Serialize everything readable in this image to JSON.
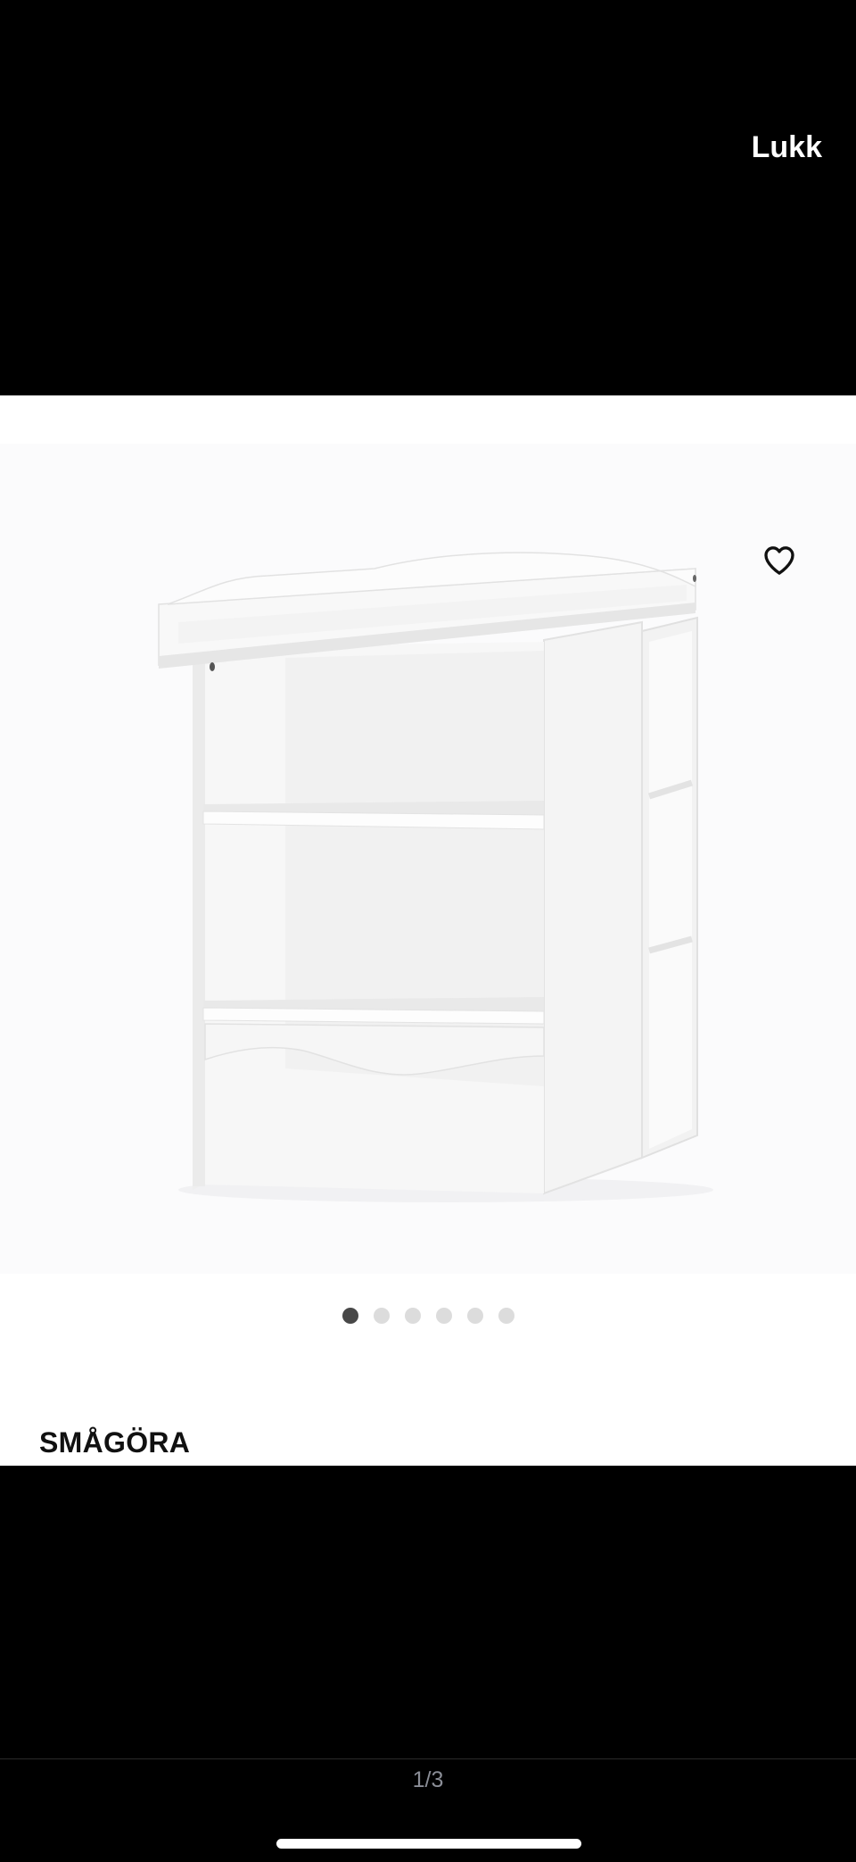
{
  "header": {
    "close_label": "Lukk"
  },
  "product": {
    "name": "SMÅGÖRA",
    "image_icon": "changing-table-bookshelf-image",
    "favorite_icon": "heart-outline-icon"
  },
  "carousel": {
    "total_dots": 6,
    "active_index": 0
  },
  "footer": {
    "page_counter": "1/3"
  },
  "colors": {
    "background": "#000000",
    "content_background": "#ffffff",
    "active_dot": "#484848",
    "inactive_dot": "#dcdcdc",
    "counter_text": "#8a8d96"
  }
}
